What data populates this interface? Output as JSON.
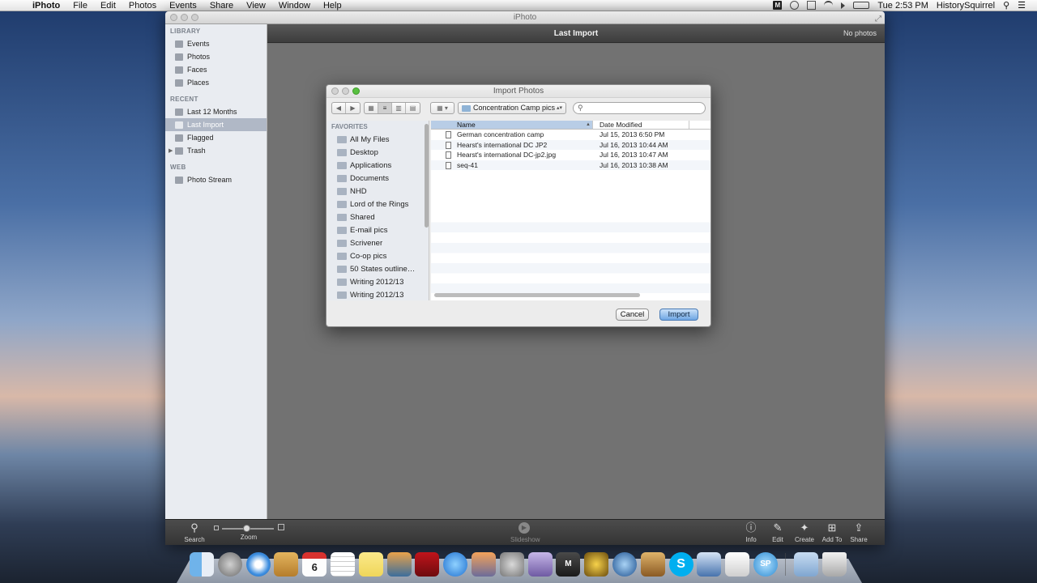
{
  "menubar": {
    "apple": "",
    "app_name": "iPhoto",
    "menus": [
      "File",
      "Edit",
      "Photos",
      "Events",
      "Share",
      "View",
      "Window",
      "Help"
    ],
    "tray_m": "M",
    "clock": "Tue 2:53 PM",
    "user": "HistorySquirrel"
  },
  "window": {
    "title": "iPhoto",
    "header_title": "Last Import",
    "photo_count": "No photos"
  },
  "sidebar": {
    "library_header": "LIBRARY",
    "library_items": [
      "Events",
      "Photos",
      "Faces",
      "Places"
    ],
    "recent_header": "RECENT",
    "recent_items": [
      "Last 12 Months",
      "Last Import",
      "Flagged",
      "Trash"
    ],
    "selected": "Last Import",
    "web_header": "WEB",
    "web_items": [
      "Photo Stream"
    ]
  },
  "toolbar": {
    "search": "Search",
    "zoom": "Zoom",
    "slideshow": "Slideshow",
    "info": "Info",
    "edit": "Edit",
    "create": "Create",
    "add_to": "Add To",
    "share": "Share"
  },
  "dialog": {
    "title": "Import Photos",
    "current_folder": "Concentration Camp pics",
    "search_placeholder": "",
    "favorites_header": "FAVORITES",
    "favorites": [
      "All My Files",
      "Desktop",
      "Applications",
      "Documents",
      "NHD",
      "Lord of the Rings",
      "Shared",
      "E-mail pics",
      "Scrivener",
      "Co-op pics",
      "50 States outline…",
      "Writing 2012/13",
      "Writing 2012/13"
    ],
    "columns": {
      "name": "Name",
      "date": "Date Modified"
    },
    "files": [
      {
        "name": "German concentration camp",
        "date": "Jul 15, 2013 6:50 PM"
      },
      {
        "name": "Hearst's international DC JP2",
        "date": "Jul 16, 2013 10:44 AM"
      },
      {
        "name": "Hearst's international DC-jp2.jpg",
        "date": "Jul 16, 2013 10:47 AM"
      },
      {
        "name": "seq-41",
        "date": "Jul 16, 2013 10:38 AM"
      }
    ],
    "cancel_label": "Cancel",
    "import_label": "Import"
  },
  "dock": {
    "calendar_day": "6",
    "mail_letter": "M",
    "skype_letter": "S",
    "sp_text": "SP"
  }
}
